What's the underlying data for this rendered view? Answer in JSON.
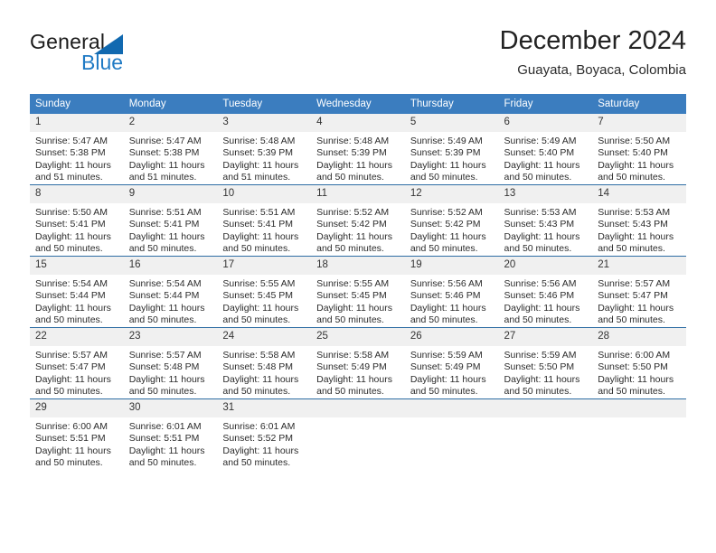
{
  "logo": {
    "word_one": "General",
    "word_two": "Blue",
    "triangle_icon": "blue-triangle-icon",
    "blue_hex": "#1f7ac4"
  },
  "header": {
    "title": "December 2024",
    "subtitle": "Guayata, Boyaca, Colombia"
  },
  "calendar": {
    "header_bg": "#3b7dbf",
    "daynum_bg": "#f0f0f0",
    "row_divider": "#2e6da4",
    "weekday_headers": [
      "Sunday",
      "Monday",
      "Tuesday",
      "Wednesday",
      "Thursday",
      "Friday",
      "Saturday"
    ],
    "weeks": [
      [
        {
          "day": "1",
          "sunrise": "Sunrise: 5:47 AM",
          "sunset": "Sunset: 5:38 PM",
          "daylight_a": "Daylight: 11 hours",
          "daylight_b": "and 51 minutes."
        },
        {
          "day": "2",
          "sunrise": "Sunrise: 5:47 AM",
          "sunset": "Sunset: 5:38 PM",
          "daylight_a": "Daylight: 11 hours",
          "daylight_b": "and 51 minutes."
        },
        {
          "day": "3",
          "sunrise": "Sunrise: 5:48 AM",
          "sunset": "Sunset: 5:39 PM",
          "daylight_a": "Daylight: 11 hours",
          "daylight_b": "and 51 minutes."
        },
        {
          "day": "4",
          "sunrise": "Sunrise: 5:48 AM",
          "sunset": "Sunset: 5:39 PM",
          "daylight_a": "Daylight: 11 hours",
          "daylight_b": "and 50 minutes."
        },
        {
          "day": "5",
          "sunrise": "Sunrise: 5:49 AM",
          "sunset": "Sunset: 5:39 PM",
          "daylight_a": "Daylight: 11 hours",
          "daylight_b": "and 50 minutes."
        },
        {
          "day": "6",
          "sunrise": "Sunrise: 5:49 AM",
          "sunset": "Sunset: 5:40 PM",
          "daylight_a": "Daylight: 11 hours",
          "daylight_b": "and 50 minutes."
        },
        {
          "day": "7",
          "sunrise": "Sunrise: 5:50 AM",
          "sunset": "Sunset: 5:40 PM",
          "daylight_a": "Daylight: 11 hours",
          "daylight_b": "and 50 minutes."
        }
      ],
      [
        {
          "day": "8",
          "sunrise": "Sunrise: 5:50 AM",
          "sunset": "Sunset: 5:41 PM",
          "daylight_a": "Daylight: 11 hours",
          "daylight_b": "and 50 minutes."
        },
        {
          "day": "9",
          "sunrise": "Sunrise: 5:51 AM",
          "sunset": "Sunset: 5:41 PM",
          "daylight_a": "Daylight: 11 hours",
          "daylight_b": "and 50 minutes."
        },
        {
          "day": "10",
          "sunrise": "Sunrise: 5:51 AM",
          "sunset": "Sunset: 5:41 PM",
          "daylight_a": "Daylight: 11 hours",
          "daylight_b": "and 50 minutes."
        },
        {
          "day": "11",
          "sunrise": "Sunrise: 5:52 AM",
          "sunset": "Sunset: 5:42 PM",
          "daylight_a": "Daylight: 11 hours",
          "daylight_b": "and 50 minutes."
        },
        {
          "day": "12",
          "sunrise": "Sunrise: 5:52 AM",
          "sunset": "Sunset: 5:42 PM",
          "daylight_a": "Daylight: 11 hours",
          "daylight_b": "and 50 minutes."
        },
        {
          "day": "13",
          "sunrise": "Sunrise: 5:53 AM",
          "sunset": "Sunset: 5:43 PM",
          "daylight_a": "Daylight: 11 hours",
          "daylight_b": "and 50 minutes."
        },
        {
          "day": "14",
          "sunrise": "Sunrise: 5:53 AM",
          "sunset": "Sunset: 5:43 PM",
          "daylight_a": "Daylight: 11 hours",
          "daylight_b": "and 50 minutes."
        }
      ],
      [
        {
          "day": "15",
          "sunrise": "Sunrise: 5:54 AM",
          "sunset": "Sunset: 5:44 PM",
          "daylight_a": "Daylight: 11 hours",
          "daylight_b": "and 50 minutes."
        },
        {
          "day": "16",
          "sunrise": "Sunrise: 5:54 AM",
          "sunset": "Sunset: 5:44 PM",
          "daylight_a": "Daylight: 11 hours",
          "daylight_b": "and 50 minutes."
        },
        {
          "day": "17",
          "sunrise": "Sunrise: 5:55 AM",
          "sunset": "Sunset: 5:45 PM",
          "daylight_a": "Daylight: 11 hours",
          "daylight_b": "and 50 minutes."
        },
        {
          "day": "18",
          "sunrise": "Sunrise: 5:55 AM",
          "sunset": "Sunset: 5:45 PM",
          "daylight_a": "Daylight: 11 hours",
          "daylight_b": "and 50 minutes."
        },
        {
          "day": "19",
          "sunrise": "Sunrise: 5:56 AM",
          "sunset": "Sunset: 5:46 PM",
          "daylight_a": "Daylight: 11 hours",
          "daylight_b": "and 50 minutes."
        },
        {
          "day": "20",
          "sunrise": "Sunrise: 5:56 AM",
          "sunset": "Sunset: 5:46 PM",
          "daylight_a": "Daylight: 11 hours",
          "daylight_b": "and 50 minutes."
        },
        {
          "day": "21",
          "sunrise": "Sunrise: 5:57 AM",
          "sunset": "Sunset: 5:47 PM",
          "daylight_a": "Daylight: 11 hours",
          "daylight_b": "and 50 minutes."
        }
      ],
      [
        {
          "day": "22",
          "sunrise": "Sunrise: 5:57 AM",
          "sunset": "Sunset: 5:47 PM",
          "daylight_a": "Daylight: 11 hours",
          "daylight_b": "and 50 minutes."
        },
        {
          "day": "23",
          "sunrise": "Sunrise: 5:57 AM",
          "sunset": "Sunset: 5:48 PM",
          "daylight_a": "Daylight: 11 hours",
          "daylight_b": "and 50 minutes."
        },
        {
          "day": "24",
          "sunrise": "Sunrise: 5:58 AM",
          "sunset": "Sunset: 5:48 PM",
          "daylight_a": "Daylight: 11 hours",
          "daylight_b": "and 50 minutes."
        },
        {
          "day": "25",
          "sunrise": "Sunrise: 5:58 AM",
          "sunset": "Sunset: 5:49 PM",
          "daylight_a": "Daylight: 11 hours",
          "daylight_b": "and 50 minutes."
        },
        {
          "day": "26",
          "sunrise": "Sunrise: 5:59 AM",
          "sunset": "Sunset: 5:49 PM",
          "daylight_a": "Daylight: 11 hours",
          "daylight_b": "and 50 minutes."
        },
        {
          "day": "27",
          "sunrise": "Sunrise: 5:59 AM",
          "sunset": "Sunset: 5:50 PM",
          "daylight_a": "Daylight: 11 hours",
          "daylight_b": "and 50 minutes."
        },
        {
          "day": "28",
          "sunrise": "Sunrise: 6:00 AM",
          "sunset": "Sunset: 5:50 PM",
          "daylight_a": "Daylight: 11 hours",
          "daylight_b": "and 50 minutes."
        }
      ],
      [
        {
          "day": "29",
          "sunrise": "Sunrise: 6:00 AM",
          "sunset": "Sunset: 5:51 PM",
          "daylight_a": "Daylight: 11 hours",
          "daylight_b": "and 50 minutes."
        },
        {
          "day": "30",
          "sunrise": "Sunrise: 6:01 AM",
          "sunset": "Sunset: 5:51 PM",
          "daylight_a": "Daylight: 11 hours",
          "daylight_b": "and 50 minutes."
        },
        {
          "day": "31",
          "sunrise": "Sunrise: 6:01 AM",
          "sunset": "Sunset: 5:52 PM",
          "daylight_a": "Daylight: 11 hours",
          "daylight_b": "and 50 minutes."
        },
        {
          "day": "",
          "sunrise": "",
          "sunset": "",
          "daylight_a": "",
          "daylight_b": ""
        },
        {
          "day": "",
          "sunrise": "",
          "sunset": "",
          "daylight_a": "",
          "daylight_b": ""
        },
        {
          "day": "",
          "sunrise": "",
          "sunset": "",
          "daylight_a": "",
          "daylight_b": ""
        },
        {
          "day": "",
          "sunrise": "",
          "sunset": "",
          "daylight_a": "",
          "daylight_b": ""
        }
      ]
    ]
  }
}
